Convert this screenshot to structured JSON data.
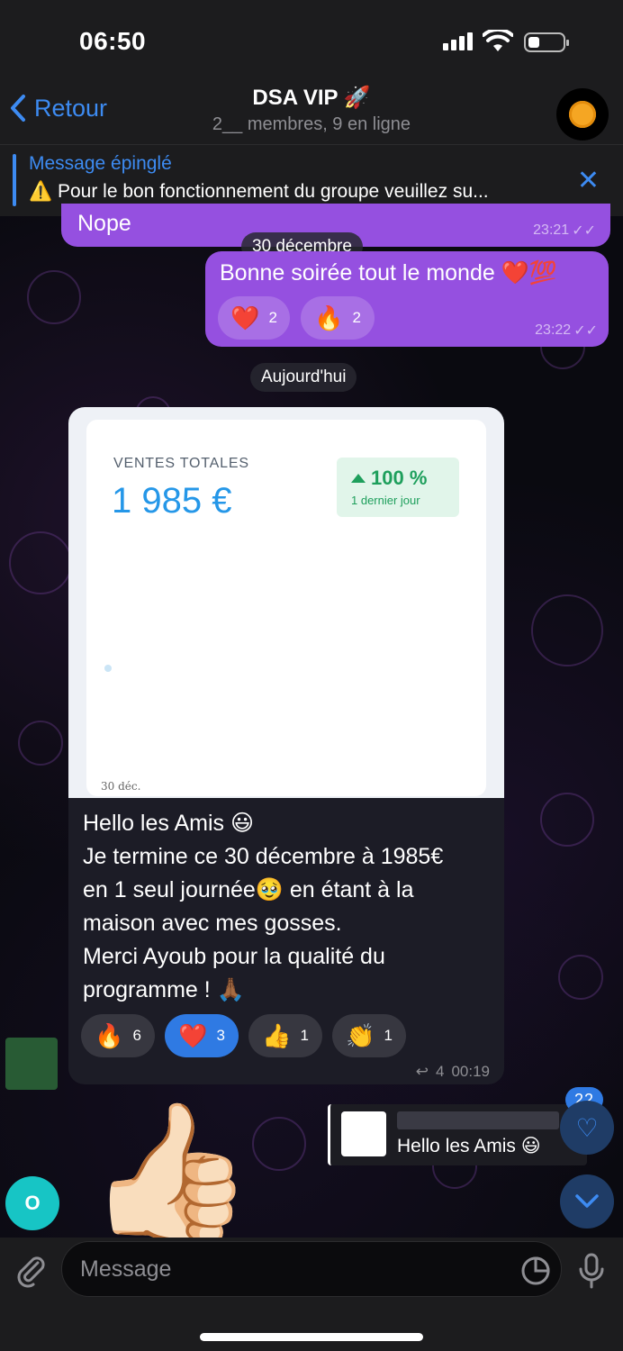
{
  "status": {
    "time": "06:50"
  },
  "header": {
    "back_label": "Retour",
    "title": "DSA VIP 🚀",
    "subtitle": "2__ membres, 9 en ligne"
  },
  "pinned": {
    "label": "Message épinglé",
    "text": "⚠️ Pour le bon fonctionnement du groupe veuillez su..."
  },
  "messages": {
    "nope": {
      "text": "Nope",
      "time": "23:21"
    },
    "date_pill_1": "30 décembre",
    "bonne": {
      "text": "Bonne soirée tout le monde ❤️💯",
      "time": "23:22",
      "reactions": [
        {
          "emoji": "❤️",
          "count": "2"
        },
        {
          "emoji": "🔥",
          "count": "2"
        }
      ]
    },
    "date_pill_2": "Aujourd'hui",
    "sales_card": {
      "label": "VENTES TOTALES",
      "value": "1 985 €",
      "badge_pct": "100 %",
      "badge_sub": "1 dernier jour",
      "tick": "30 déc."
    },
    "hello": {
      "lines": [
        "Hello les Amis 😃",
        "Je termine ce 30 décembre à 1985€",
        "en 1 seul journée🥹 en étant à la",
        "maison avec mes gosses.",
        "Merci Ayoub pour la qualité du",
        "programme ! 🙏🏾"
      ],
      "reactions": [
        {
          "emoji": "🔥",
          "count": "6"
        },
        {
          "emoji": "❤️",
          "count": "3"
        },
        {
          "emoji": "👍",
          "count": "1"
        },
        {
          "emoji": "👏",
          "count": "1"
        }
      ],
      "replies": "4",
      "time": "00:19"
    },
    "reply_preview_text": "Hello les Amis 😃",
    "sticker": "👍🏻"
  },
  "floating": {
    "count": "22",
    "o_avatar": "O"
  },
  "input": {
    "placeholder": "Message"
  }
}
